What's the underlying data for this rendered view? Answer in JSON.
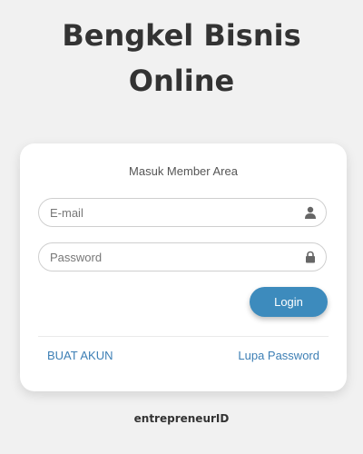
{
  "header": {
    "title_line1": "Bengkel Bisnis",
    "title_line2": "Online"
  },
  "login_card": {
    "heading": "Masuk Member Area",
    "email": {
      "placeholder": "E-mail",
      "value": "",
      "icon": "user-icon"
    },
    "password": {
      "placeholder": "Password",
      "value": "",
      "icon": "lock-icon"
    },
    "login_label": "Login",
    "register_label": "BUAT AKUN",
    "forgot_label": "Lupa Password"
  },
  "footer": {
    "brand": "entrepreneurID"
  },
  "colors": {
    "background": "#f1f1f1",
    "accent": "#3d8bbd",
    "link": "#3d7fb5",
    "text": "#333333"
  }
}
